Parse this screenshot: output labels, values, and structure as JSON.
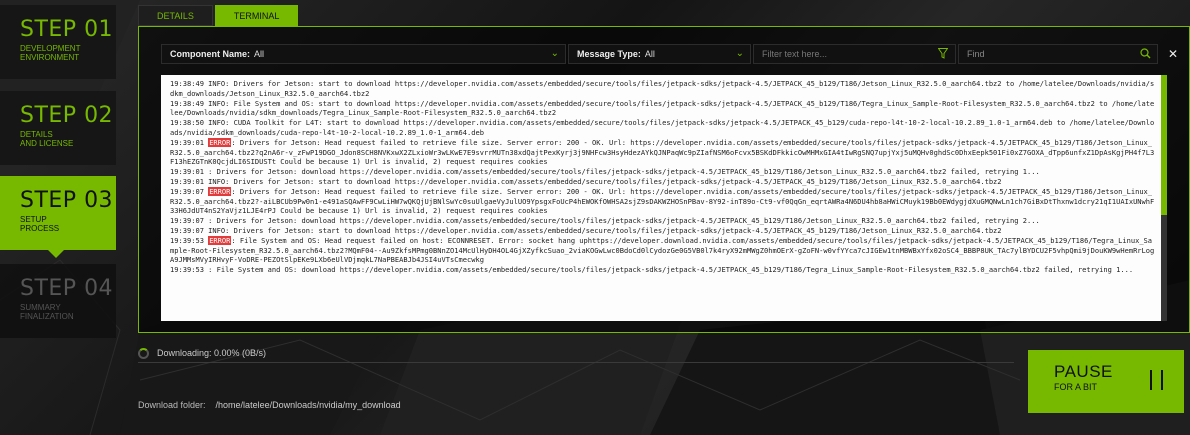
{
  "colors": {
    "accent": "#76b900",
    "error": "#e23b3b",
    "background": "#1a1a1a"
  },
  "steps": [
    {
      "number": "STEP 01",
      "label_line1": "DEVELOPMENT",
      "label_line2": "ENVIRONMENT",
      "state": "done"
    },
    {
      "number": "STEP 02",
      "label_line1": "DETAILS",
      "label_line2": "AND LICENSE",
      "state": "done"
    },
    {
      "number": "STEP 03",
      "label_line1": "SETUP",
      "label_line2": "PROCESS",
      "state": "active"
    },
    {
      "number": "STEP 04",
      "label_line1": "SUMMARY",
      "label_line2": "FINALIZATION",
      "state": "pending"
    }
  ],
  "tabs": [
    {
      "label": "DETAILS",
      "active": false
    },
    {
      "label": "TERMINAL",
      "active": true
    }
  ],
  "filters": {
    "component_label": "Component Name:",
    "component_value": "All",
    "message_label": "Message Type:",
    "message_value": "All",
    "text_placeholder": "Filter text here...",
    "find_placeholder": "Find",
    "funnel_icon": "funnel-icon",
    "search_icon": "search-icon",
    "chevron_icon": "chevron-down-icon",
    "close_icon": "close-icon"
  },
  "log_lines": [
    {
      "text": "19:38:49 INFO: Drivers for Jetson: start to download https://developer.nvidia.com/assets/embedded/secure/tools/files/jetpack-sdks/jetpack-4.5/JETPACK_45_b129/T186/Jetson_Linux_R32.5.0_aarch64.tbz2 to /home/latelee/Downloads/nvidia/sdkm_downloads/Jetson_Linux_R32.5.0_aarch64.tbz2"
    },
    {
      "text": "19:38:49 INFO: File System and OS: start to download https://developer.nvidia.com/assets/embedded/secure/tools/files/jetpack-sdks/jetpack-4.5/JETPACK_45_b129/T186/Tegra_Linux_Sample-Root-Filesystem_R32.5.0_aarch64.tbz2 to /home/latelee/Downloads/nvidia/sdkm_downloads/Tegra_Linux_Sample-Root-Filesystem_R32.5.0_aarch64.tbz2"
    },
    {
      "text": "19:38:50 INFO: CUDA Toolkit for L4T: start to download https://developer.nvidia.com/assets/embedded/secure/tools/files/jetpack-sdks/jetpack-4.5/JETPACK_45_b129/cuda-repo-l4t-10-2-local-10.2.89_1.0-1_arm64.deb to /home/latelee/Downloads/nvidia/sdkm_downloads/cuda-repo-l4t-10-2-local-10.2.89_1.0-1_arm64.deb"
    },
    {
      "prefix": "19:39:01 ",
      "tag": "ERROR",
      "text": ": Drivers for Jetson: Head request failed to retrieve file size. Server error: 200 - OK. Url: https://developer.nvidia.com/assets/embedded/secure/tools/files/jetpack-sdks/jetpack-4.5/JETPACK_45_b129/T186/Jetson_Linux_R32.5.0_aarch64.tbz2?q2nA6r-v_zFwP19DGO_Jdon8SCH8NVKxwX2ZLxioWr3wLKwE7E9svrrMUTn38xdQajtPexKyrj3j9NHFcw3HsyHdezAYkQJNPaqWc9pZIafNSM6oFcvx5BSKdDFkkicOwMHMxGIA4tIwRgSNQ7upjYxj5uMQHv0ghdSc0DhxEepk501Fi0xZ7GOXA_dTpp6unfxZ1DpAsKgjPH4f7L3F13hEZGTnK0QcjdLI6SIDUSTt Could be because 1) Url is invalid, 2) request requires cookies"
    },
    {
      "text": "19:39:01 : Drivers for Jetson: download https://developer.nvidia.com/assets/embedded/secure/tools/files/jetpack-sdks/jetpack-4.5/JETPACK_45_b129/T186/Jetson_Linux_R32.5.0_aarch64.tbz2 failed, retrying 1..."
    },
    {
      "text": "19:39:01 INFO: Drivers for Jetson: start to download https://developer.nvidia.com/assets/embedded/secure/tools/files/jetpack-sdks/jetpack-4.5/JETPACK_45_b129/T186/Jetson_Linux_R32.5.0_aarch64.tbz2"
    },
    {
      "prefix": "19:39:07 ",
      "tag": "ERROR",
      "text": ": Drivers for Jetson: Head request failed to retrieve file size. Server error: 200 - OK. Url: https://developer.nvidia.com/assets/embedded/secure/tools/files/jetpack-sdks/jetpack-4.5/JETPACK_45_b129/T186/Jetson_Linux_R32.5.0_aarch64.tbz2?-aiLBCUb9Pw0n1-e491aSQAwFF9CwLiHW7wQKQjUjBNlSwYc0suUlgaeVyJulUO9YpsgxFoUcP4hEWOKfOWHSA2sjZ9sDAKWZHOSnPBav-8Y92-inT89o-Ct9-vf0QqGn_eqrtAWRa4N6DU4hb8aHWiCMuyk19Bb0EWdygjdXuGMQNwLn1ch7GiBxDtThxnw1dcry21qI1UAIxUNwhF33H6JdUT4nS2YaVjz1LJE4rPJ Could be because 1) Url is invalid, 2) request requires cookies"
    },
    {
      "text": "19:39:07 : Drivers for Jetson: download https://developer.nvidia.com/assets/embedded/secure/tools/files/jetpack-sdks/jetpack-4.5/JETPACK_45_b129/T186/Jetson_Linux_R32.5.0_aarch64.tbz2 failed, retrying 2..."
    },
    {
      "text": "19:39:07 INFO: Drivers for Jetson: start to download https://developer.nvidia.com/assets/embedded/secure/tools/files/jetpack-sdks/jetpack-4.5/JETPACK_45_b129/T186/Jetson_Linux_R32.5.0_aarch64.tbz2"
    },
    {
      "prefix": "19:39:53 ",
      "tag": "ERROR",
      "text": ": File System and OS: Head request failed on host: ECONNRESET. Error: socket hang uphttps://developer.download.nvidia.com/assets/embedded/secure/tools/files/jetpack-sdks/jetpack-4.5/JETPACK_45_b129/T186/Tegra_Linux_Sample-Root-Filesystem_R32.5.0_aarch64.tbz2?MQmF04--Au9ZkfsMPmg0BNnZO14McUlHyDH4OL4GjXZyfkcSuao_2viaKOGwLwc0BdoCd0lCydozGe0G5VB0l7k4ryX92mMWgZ0hmOErX-gZoFN-w0vfYYca7cJIGEw1tnMBWBxYfx02oSC4_BBBP8UK_TAc7ylBYDCU2F5vhpQmi9jDouKW9wHemRrLogA9JMMsMVyIRHvyF-VoDRE-PEZOtSlpEKe9LXb6eUlVDjmqkL7NaPBEABJb4JSI4uVTsCmecwkg"
    },
    {
      "text": "19:39:53 : File System and OS: download https://developer.nvidia.com/assets/embedded/secure/tools/files/jetpack-sdks/jetpack-4.5/JETPACK_45_b129/T186/Tegra_Linux_Sample-Root-Filesystem_R32.5.0_aarch64.tbz2 failed, retrying 1..."
    }
  ],
  "progress": {
    "label": "Downloading: 0.00% (0B/s)",
    "fraction": 0.0
  },
  "download_folder": {
    "label": "Download folder:",
    "path": "/home/latelee/Downloads/nvidia/my_download"
  },
  "pause_button": {
    "title": "PAUSE",
    "subtitle": "FOR A BIT",
    "icon": "pause-icon"
  }
}
